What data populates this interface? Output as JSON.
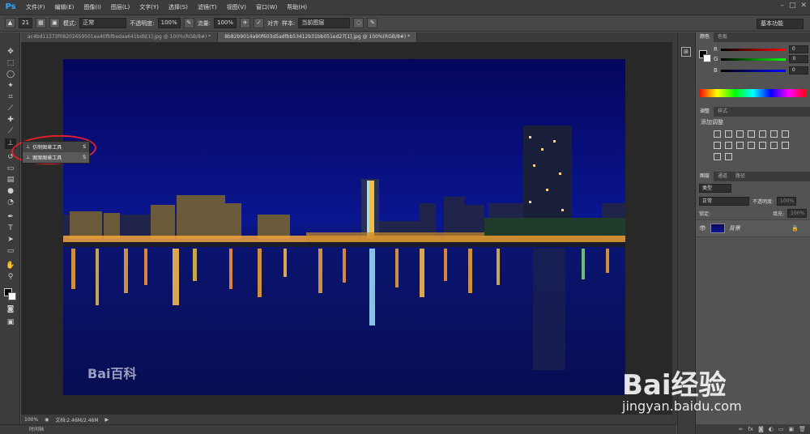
{
  "app": {
    "logo": "Ps"
  },
  "menu": [
    "文件(F)",
    "编辑(E)",
    "图像(I)",
    "图层(L)",
    "文字(Y)",
    "选择(S)",
    "滤镜(T)",
    "视图(V)",
    "窗口(W)",
    "帮助(H)"
  ],
  "options": {
    "brush_size": "21",
    "mode_label": "模式:",
    "mode_value": "正常",
    "opacity_label": "不透明度:",
    "opacity_value": "100%",
    "flow_label": "流量:",
    "flow_value": "100%",
    "align_label": "对齐",
    "sample_label": "样本:",
    "sample_value": "当前图层",
    "workspace": "基本功能"
  },
  "tabs": [
    {
      "label": "ac4bd11373f08202659501ea40fbfbedaa641bdb[1].jpg @ 100%(RGB/8#) *",
      "active": false
    },
    {
      "label": "8b82b9014a90f603d5adfbb53412b31bb051ed27[1].jpg @ 100%(RGB/8#) *",
      "active": true
    }
  ],
  "popup": {
    "items": [
      {
        "label": "仿制图章工具",
        "shortcut": "S"
      },
      {
        "label": "图案图章工具",
        "shortcut": "S"
      }
    ]
  },
  "status": {
    "zoom": "100%",
    "doc": "文档:2.46M/2.46M"
  },
  "timeline": "时间轴",
  "panels": {
    "color_tab": "颜色",
    "swatches_tab": "色板",
    "r_label": "R",
    "g_label": "G",
    "b_label": "B",
    "r_value": "0",
    "g_value": "0",
    "b_value": "0",
    "adjust_tab": "调整",
    "styles_tab": "样式",
    "add_adjustment": "添加调整",
    "layers_tab": "图层",
    "channels_tab": "通道",
    "paths_tab": "路径",
    "kind_value": "类型",
    "blend_value": "正常",
    "opacity_label": "不透明度:",
    "opacity_value": "100%",
    "lock_label": "锁定:",
    "fill_label": "填充:",
    "fill_value": "100%",
    "layer_name": "背景"
  },
  "watermarks": {
    "baike": "Bai百科",
    "jingyan_cn": "Bai经验",
    "jingyan_url": "jingyan.baidu.com"
  },
  "colors": {
    "accent_ps": "#31a8ff",
    "annotation_red": "#e0202a",
    "sky": "#0a1690"
  }
}
